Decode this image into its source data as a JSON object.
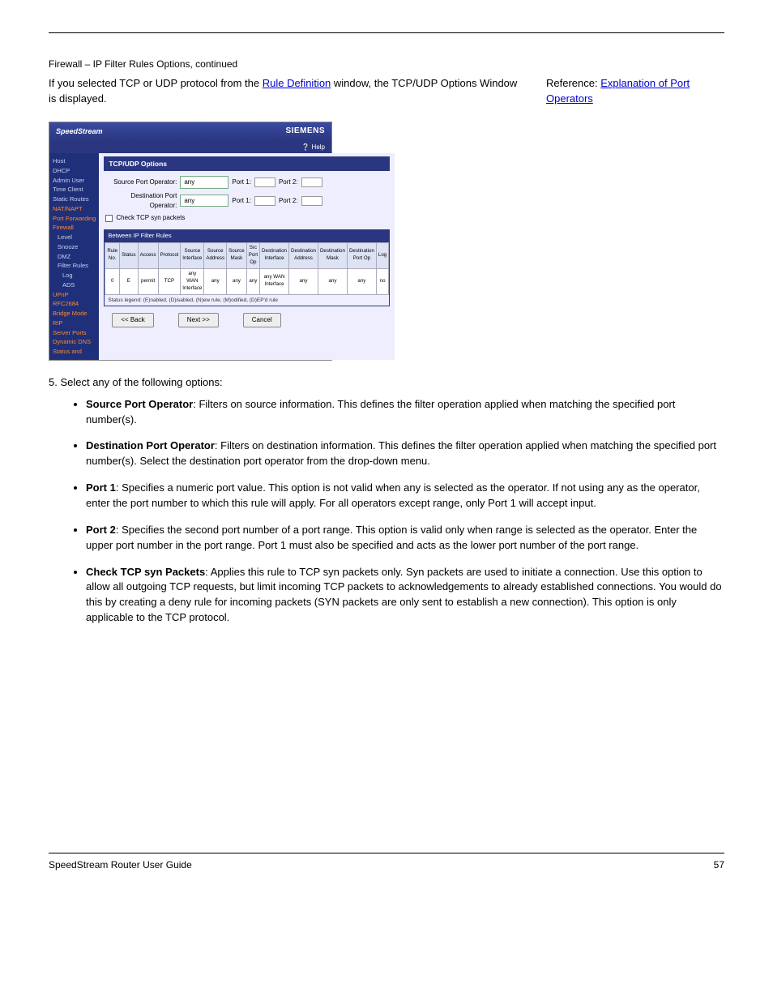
{
  "page": {
    "continued_label": "Firewall – IP Filter Rules Options, continued",
    "intro_sentence_prefix": "If you selected TCP or UDP protocol from the ",
    "intro_sentence_link": "Rule Definition",
    "intro_sentence_suffix": " window, the TCP/UDP Options Window is displayed.",
    "reference_prefix": "Reference: ",
    "reference_link": "Explanation of Port Operators"
  },
  "screenshot": {
    "brand": "SpeedStream",
    "logo": "SIEMENS",
    "help": "Help",
    "title": "TCP/UDP Options",
    "rows": {
      "src_label": "Source Port Operator:",
      "dst_label": "Destination Port Operator:",
      "sel_value": "any",
      "port1_label": "Port 1:",
      "port2_label": "Port 2:"
    },
    "checkbox": "Check TCP syn packets",
    "table": {
      "header": "Between IP Filter Rules",
      "cols": [
        "Rule No.",
        "Status",
        "Access",
        "Protocol",
        "Source Interface",
        "Source Address",
        "Source Mask",
        "Src Port Op",
        "Destination Interface",
        "Destination Address",
        "Destination Mask",
        "Destination Port Op",
        "Log"
      ],
      "row": [
        "0",
        "E",
        "permit",
        "TCP",
        "any WAN Interface",
        "any",
        "any",
        "any",
        "any WAN Interface",
        "any",
        "any",
        "any",
        "no"
      ],
      "legend": "Status legend: (E)nabled, (D)isabled, (N)ew rule, (M)odified, (D)EP'd rule"
    },
    "buttons": {
      "back": "<< Back",
      "next": "Next >>",
      "cancel": "Cancel"
    },
    "sidebar": {
      "items": [
        "Host",
        "DHCP",
        "Admin User",
        "Time Client",
        "Static Routes",
        "NAT/NAPT",
        "Port Forwarding",
        "Firewall",
        "Level",
        "Snooze",
        "DMZ",
        "Filter Rules",
        "Log",
        "ADS",
        "UPnP",
        "RFC2684",
        "Bridge Mode",
        "RIP",
        "Server Ports",
        "Dynamic DNS",
        "Status and"
      ]
    }
  },
  "step_text": "5. Select any of the following options:",
  "options": [
    {
      "name": "Source Port Operator",
      "colon": ": ",
      "desc": "Filters on source information. This defines the filter operation applied when matching the specified port number(s)."
    },
    {
      "name": "Destination Port Operator",
      "colon": ": ",
      "desc": "Filters on destination information. This defines the filter operation applied when matching the specified port number(s). Select the destination port operator from the drop-down menu."
    },
    {
      "name": "Port 1",
      "colon": ": ",
      "desc": "Specifies a numeric port value. This option is not valid when any is selected as the operator. If not using any as the operator, enter the port number to which this rule will apply. For all operators except range, only Port 1 will accept input."
    },
    {
      "name": "Port 2",
      "colon": ": ",
      "desc": "Specifies the second port number of a port range. This option is valid only when range is selected as the operator. Enter the upper port number in the port range. Port 1 must also be specified and acts as the lower port number of the port range."
    },
    {
      "name": "Check TCP syn Packets",
      "colon": ": ",
      "desc": "Applies this rule to TCP syn packets only. Syn packets are used to initiate a connection. Use this option to allow all outgoing TCP requests, but limit incoming TCP packets to acknowledgements to already established connections. You would do this by creating a deny rule for incoming packets (SYN packets are only sent to establish a new connection). This option is only applicable to the TCP protocol."
    }
  ],
  "footer": {
    "left": "SpeedStream Router User Guide",
    "right": "57"
  }
}
